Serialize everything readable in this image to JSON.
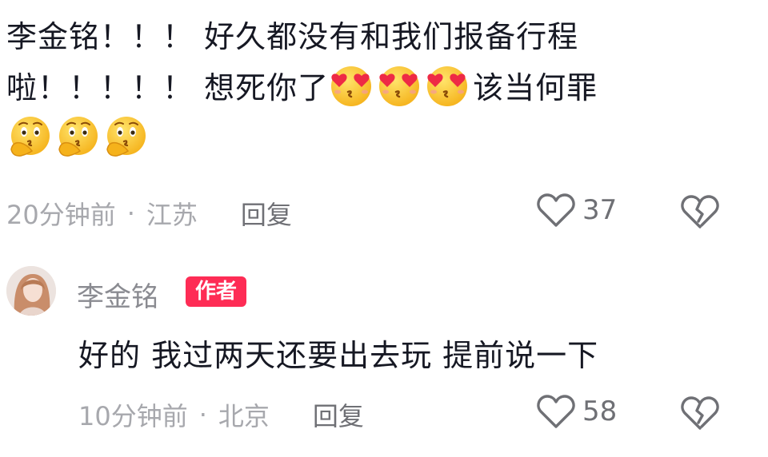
{
  "comment": {
    "line1": "李金铭！！！ 好久都没有和我们报备行程",
    "line2_before": "啦！！！！！ 想死你了",
    "line2_after": "该当何罪",
    "emoji_heart_eyes": "heart-eyes-kiss-emoji",
    "emoji_thinking": "thinking-emoji",
    "time": "20分钟前",
    "location": "江苏",
    "reply_label": "回复",
    "likes": "37"
  },
  "reply": {
    "username": "李金铭",
    "badge": "作者",
    "text": "好的 我过两天还要出去玩 提前说一下",
    "time": "10分钟前",
    "location": "北京",
    "reply_label": "回复",
    "likes": "58"
  },
  "separator": "·",
  "colors": {
    "badge": "#fe2c55",
    "meta": "#a7a8ad",
    "text": "#161823"
  }
}
